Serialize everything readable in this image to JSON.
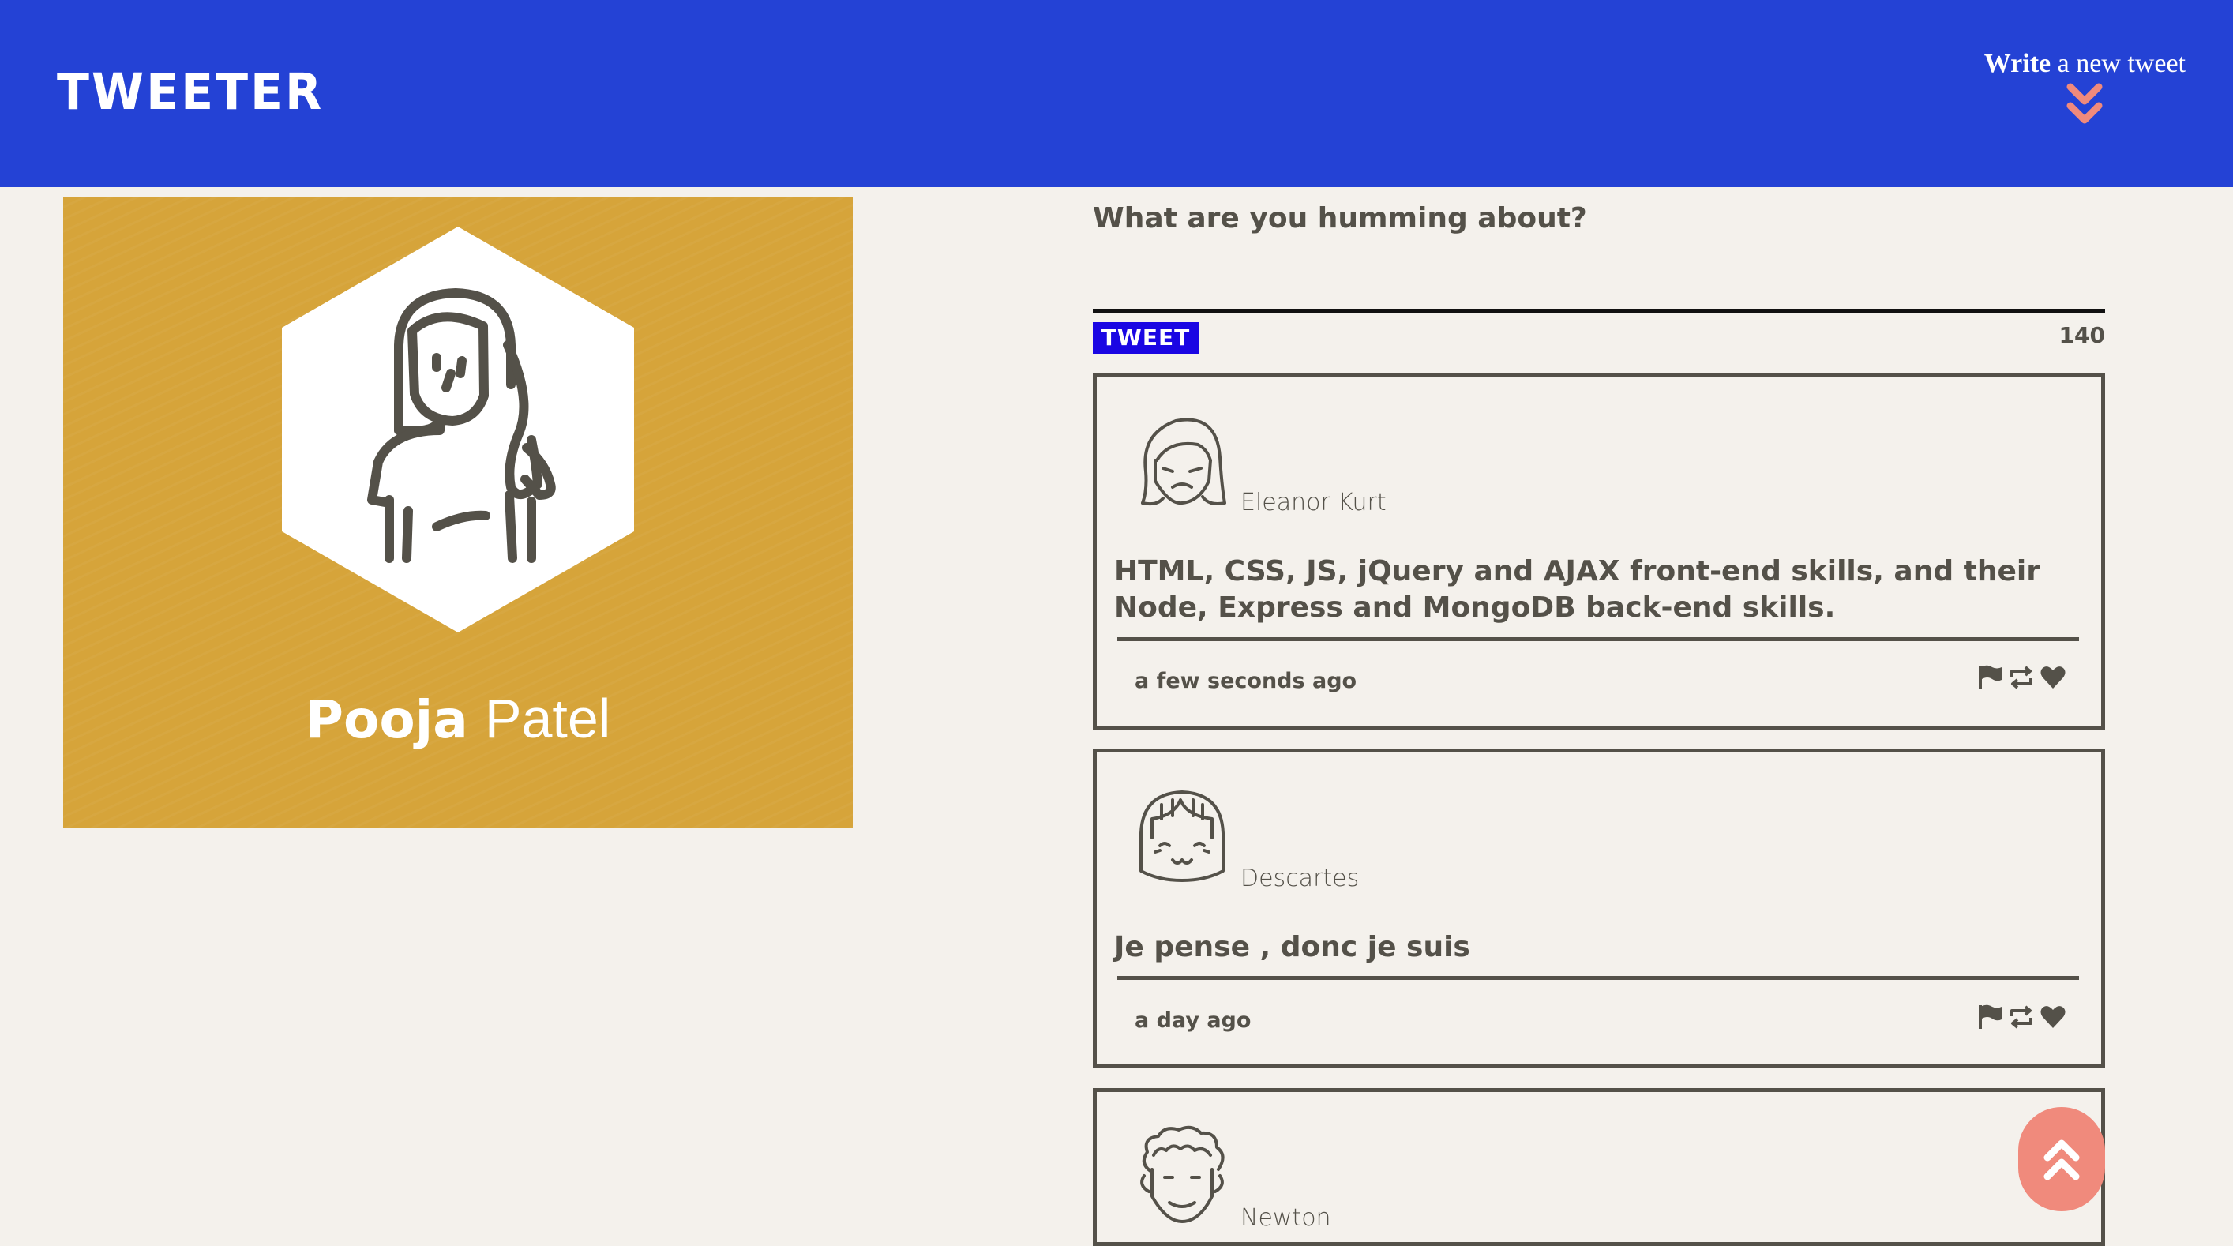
{
  "nav": {
    "logo": "TWEETER",
    "compose_bold": "Write",
    "compose_rest": " a new tweet",
    "compose_arrow_icon": "double-chevron-down-icon"
  },
  "profile": {
    "first_name": "Pooja",
    "last_name": "Patel",
    "background_color": "#d6a43a",
    "avatar_icon": "girl-avatar-icon"
  },
  "composer": {
    "prompt": "What are you humming about?",
    "submit_label": "TWEET",
    "counter": "140"
  },
  "tweets": [
    {
      "name": "Eleanor Kurt",
      "avatar_icon": "woman-avatar-icon",
      "content": "HTML, CSS, JS, jQuery and AJAX front-end skills, and their Node, Express and MongoDB back-end skills.",
      "time": "a few seconds ago"
    },
    {
      "name": "Descartes",
      "avatar_icon": "bob-hair-avatar-icon",
      "content": "Je pense , donc je suis",
      "time": "a day ago"
    },
    {
      "name": "Newton",
      "avatar_icon": "curly-hair-avatar-icon",
      "content": "",
      "time": ""
    }
  ],
  "actions": [
    "flag-icon",
    "retweet-icon",
    "heart-icon"
  ],
  "colors": {
    "nav": "#2442d5",
    "accent": "#f08a7c",
    "tweet_button": "#1a06e3",
    "text": "#545149",
    "page": "#f4f1ec"
  },
  "scroll_top_icon": "double-chevron-up-icon"
}
